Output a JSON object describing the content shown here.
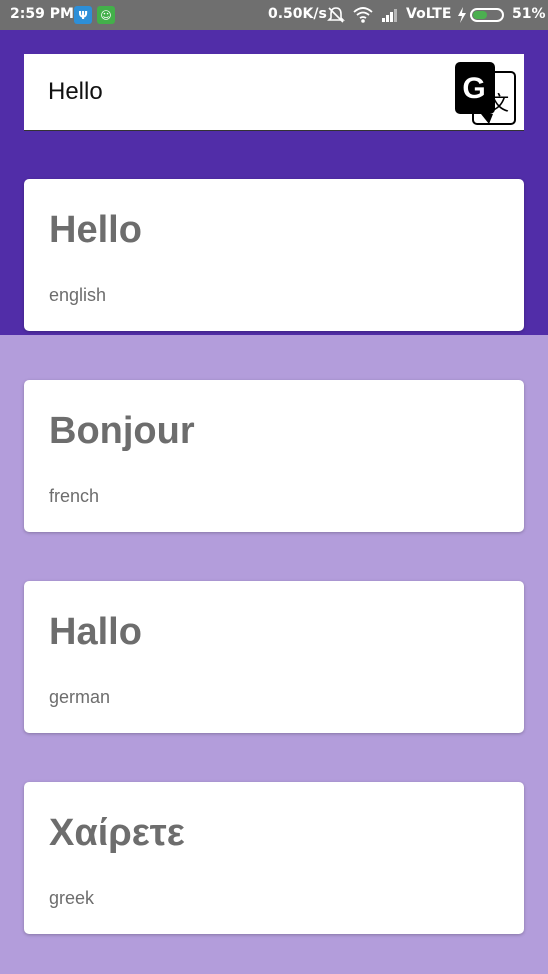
{
  "status_bar": {
    "time": "2:59 PM",
    "network_speed": "0.50K/s",
    "network_type": "VoLTE",
    "battery_percent": "51%",
    "battery_level": 0.51,
    "icons": [
      "usb-icon",
      "android-icon",
      "mute-icon",
      "wifi-icon",
      "signal-icon",
      "charging-icon",
      "battery-icon"
    ]
  },
  "search": {
    "value": "Hello",
    "translate_icon": "google-translate-icon"
  },
  "colors": {
    "header": "#512da8",
    "background": "#b39ddb",
    "card": "#ffffff",
    "text": "#6d6d6d"
  },
  "translations": [
    {
      "word": "Hello",
      "language": "english"
    },
    {
      "word": "Bonjour",
      "language": "french"
    },
    {
      "word": "Hallo",
      "language": "german"
    },
    {
      "word": "Χαίρετε",
      "language": "greek"
    }
  ]
}
